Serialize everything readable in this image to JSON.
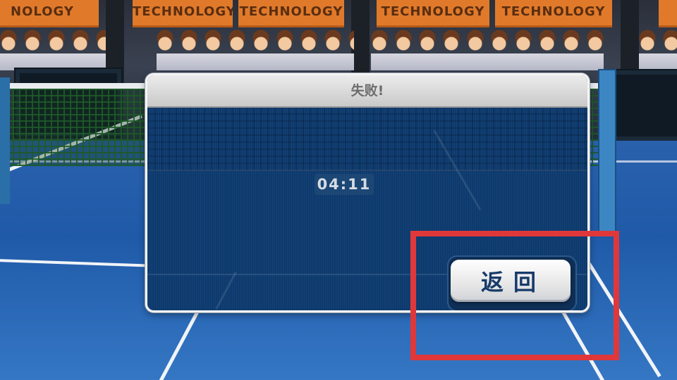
{
  "background": {
    "banners": [
      "NOLOGY",
      "TECHNOLOGY",
      "TECHNOLOGY",
      "TECHNOLOGY",
      "TECHNOLOGY"
    ],
    "court_color": "#2a61ad",
    "line_color": "#f1f4f8"
  },
  "dialog": {
    "title": "失败!",
    "elapsed_time": "04:11",
    "return_button_label": "返回"
  },
  "highlight": {
    "color": "#e0383a",
    "target": "return-button"
  }
}
